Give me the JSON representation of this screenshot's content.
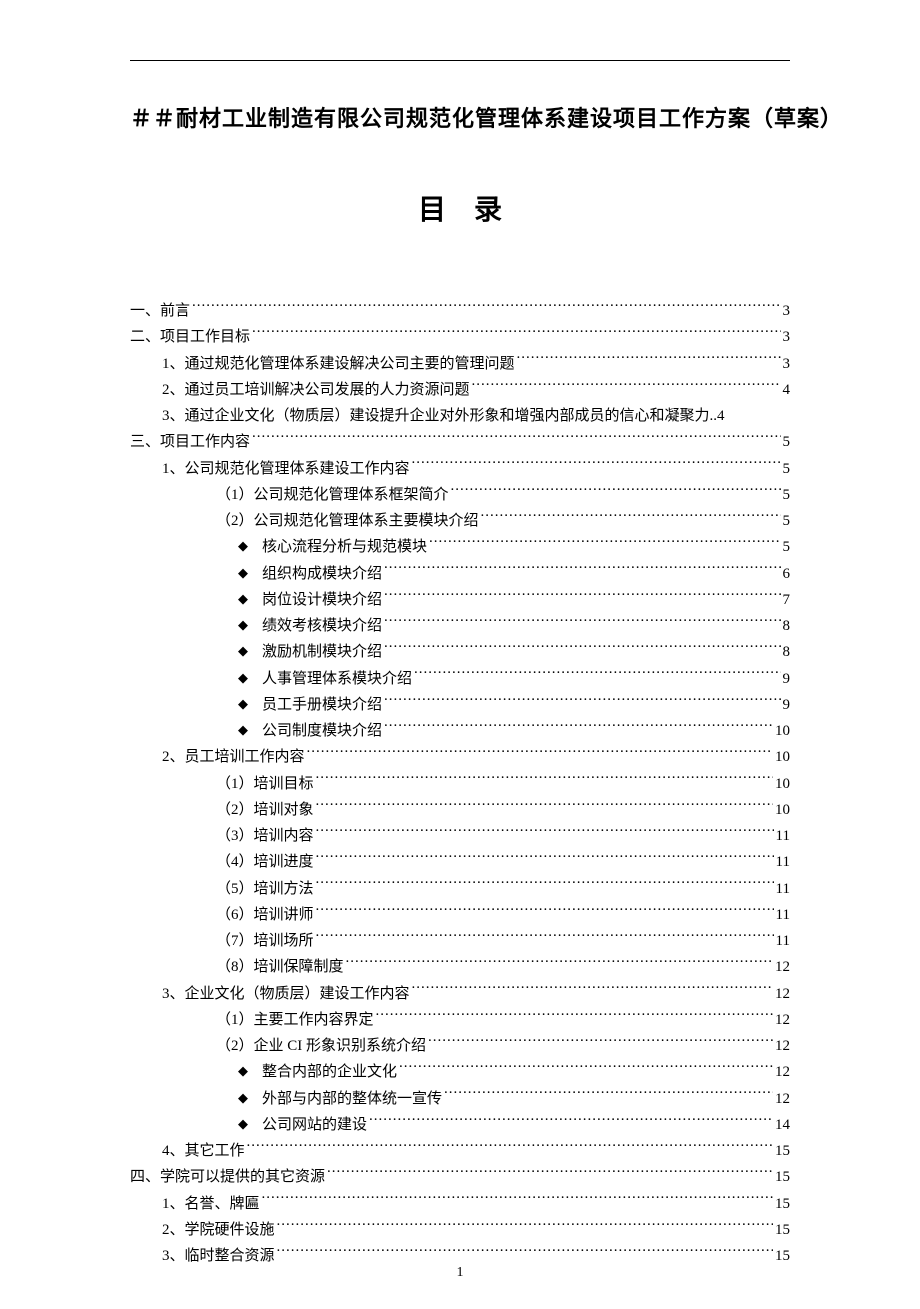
{
  "doc_title": "＃＃耐材工业制造有限公司规范化管理体系建设项目工作方案（草案）",
  "toc_heading": "目录",
  "page_number": "1",
  "toc": [
    {
      "level": 0,
      "bullet": false,
      "label": "一、前言",
      "page": "3"
    },
    {
      "level": 0,
      "bullet": false,
      "label": "二、项目工作目标",
      "page": "3"
    },
    {
      "level": 1,
      "bullet": false,
      "label": "1、通过规范化管理体系建设解决公司主要的管理问题",
      "page": "3"
    },
    {
      "level": 1,
      "bullet": false,
      "label": "2、通过员工培训解决公司发展的人力资源问题",
      "page": "4"
    },
    {
      "level": 1,
      "bullet": false,
      "label": "3、通过企业文化（物质层）建设提升企业对外形象和增强内部成员的信心和凝聚力",
      "page": "4",
      "no_leader": true
    },
    {
      "level": 0,
      "bullet": false,
      "label": "三、项目工作内容",
      "page": "5"
    },
    {
      "level": 1,
      "bullet": false,
      "label": "1、公司规范化管理体系建设工作内容",
      "page": "5"
    },
    {
      "level": 2,
      "bullet": false,
      "label": "（1）公司规范化管理体系框架简介",
      "page": "5"
    },
    {
      "level": 2,
      "bullet": false,
      "label": "（2）公司规范化管理体系主要模块介绍",
      "page": "5"
    },
    {
      "level": 3,
      "bullet": true,
      "label": "核心流程分析与规范模块",
      "page": "5"
    },
    {
      "level": 3,
      "bullet": true,
      "label": "组织构成模块介绍",
      "page": "6"
    },
    {
      "level": 3,
      "bullet": true,
      "label": "岗位设计模块介绍",
      "page": "7"
    },
    {
      "level": 3,
      "bullet": true,
      "label": "绩效考核模块介绍",
      "page": "8"
    },
    {
      "level": 3,
      "bullet": true,
      "label": "激励机制模块介绍",
      "page": "8"
    },
    {
      "level": 3,
      "bullet": true,
      "label": "人事管理体系模块介绍",
      "page": "9"
    },
    {
      "level": 3,
      "bullet": true,
      "label": "员工手册模块介绍",
      "page": "9"
    },
    {
      "level": 3,
      "bullet": true,
      "label": "公司制度模块介绍",
      "page": "10"
    },
    {
      "level": 1,
      "bullet": false,
      "label": "2、员工培训工作内容",
      "page": "10"
    },
    {
      "level": 2,
      "bullet": false,
      "label": "（1）培训目标",
      "page": "10"
    },
    {
      "level": 2,
      "bullet": false,
      "label": "（2）培训对象",
      "page": "10"
    },
    {
      "level": 2,
      "bullet": false,
      "label": "（3）培训内容",
      "page": "11"
    },
    {
      "level": 2,
      "bullet": false,
      "label": "（4）培训进度",
      "page": "11"
    },
    {
      "level": 2,
      "bullet": false,
      "label": "（5）培训方法",
      "page": "11"
    },
    {
      "level": 2,
      "bullet": false,
      "label": "（6）培训讲师",
      "page": "11"
    },
    {
      "level": 2,
      "bullet": false,
      "label": "（7）培训场所",
      "page": "11"
    },
    {
      "level": 2,
      "bullet": false,
      "label": "（8）培训保障制度",
      "page": "12"
    },
    {
      "level": 1,
      "bullet": false,
      "label": "3、企业文化（物质层）建设工作内容",
      "page": "12"
    },
    {
      "level": 2,
      "bullet": false,
      "label": "（1）主要工作内容界定",
      "page": "12"
    },
    {
      "level": 2,
      "bullet": false,
      "label": "（2）企业 CI 形象识别系统介绍",
      "page": "12"
    },
    {
      "level": 3,
      "bullet": true,
      "label": "整合内部的企业文化",
      "page": "12"
    },
    {
      "level": 3,
      "bullet": true,
      "label": "外部与内部的整体统一宣传",
      "page": "12"
    },
    {
      "level": 3,
      "bullet": true,
      "label": "公司网站的建设",
      "page": "14"
    },
    {
      "level": 1,
      "bullet": false,
      "label": "4、其它工作",
      "page": "15"
    },
    {
      "level": 0,
      "bullet": false,
      "label": "四、学院可以提供的其它资源",
      "page": "15"
    },
    {
      "level": 1,
      "bullet": false,
      "label": "1、名誉、牌匾",
      "page": "15"
    },
    {
      "level": 1,
      "bullet": false,
      "label": "2、学院硬件设施",
      "page": "15"
    },
    {
      "level": 1,
      "bullet": false,
      "label": "3、临时整合资源",
      "page": "15"
    }
  ]
}
